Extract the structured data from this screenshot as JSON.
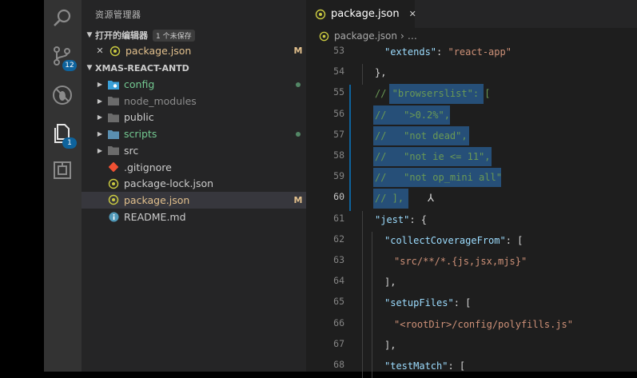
{
  "colors": {
    "accent": "#0e639c",
    "modified": "#e2c08d",
    "git_added": "#73c991",
    "json_icon": "#cbcb41"
  },
  "activity_bar": {
    "items": [
      {
        "name": "search-icon"
      },
      {
        "name": "source-control-icon",
        "badge": "12"
      },
      {
        "name": "debug-icon"
      },
      {
        "name": "explorer-icon",
        "badge": "1"
      },
      {
        "name": "extensions-icon"
      }
    ]
  },
  "sidebar": {
    "title": "资源管理器",
    "open_editors": {
      "header": "打开的编辑器",
      "badge": "1 个未保存",
      "items": [
        {
          "close": "✕",
          "label": "package.json",
          "status": "M"
        }
      ]
    },
    "project": {
      "header": "XMAS-REACT-ANTD",
      "items": [
        {
          "label": "config",
          "type": "folder",
          "icon": "config-folder-icon",
          "color": "#73c991"
        },
        {
          "label": "node_modules",
          "type": "folder",
          "icon": "node-modules-folder-icon",
          "color": "#8c8c8c"
        },
        {
          "label": "public",
          "type": "folder",
          "icon": "public-folder-icon",
          "color": "#cccccc"
        },
        {
          "label": "scripts",
          "type": "folder",
          "icon": "scripts-folder-icon",
          "color": "#73c991"
        },
        {
          "label": "src",
          "type": "folder",
          "icon": "src-folder-icon",
          "color": "#cccccc"
        },
        {
          "label": ".gitignore",
          "type": "file",
          "icon": "git-icon",
          "color": "#cccccc"
        },
        {
          "label": "package-lock.json",
          "type": "file",
          "icon": "json-file-icon",
          "color": "#cccccc"
        },
        {
          "label": "package.json",
          "type": "file",
          "icon": "json-file-icon",
          "color": "#e2c08d",
          "status": "M"
        },
        {
          "label": "README.md",
          "type": "file",
          "icon": "info-icon",
          "color": "#cccccc"
        }
      ]
    }
  },
  "editor": {
    "tab": {
      "label": "package.json",
      "close": "✕"
    },
    "breadcrumb": {
      "file": "package.json",
      "more": "…"
    },
    "lines": [
      {
        "num": "53",
        "text": "\"extends\": \"react-app\""
      },
      {
        "num": "54",
        "text": "},"
      },
      {
        "num": "55",
        "text": "// \"browserslist\": ["
      },
      {
        "num": "56",
        "text": "//   \">0.2%\","
      },
      {
        "num": "57",
        "text": "//   \"not dead\","
      },
      {
        "num": "58",
        "text": "//   \"not ie <= 11\","
      },
      {
        "num": "59",
        "text": "//   \"not op_mini all\""
      },
      {
        "num": "60",
        "text": "// ],"
      },
      {
        "num": "61",
        "text": "\"jest\": {"
      },
      {
        "num": "62",
        "text": "\"collectCoverageFrom\": ["
      },
      {
        "num": "63",
        "text": "\"src/**/*.{js,jsx,mjs}\""
      },
      {
        "num": "64",
        "text": "],"
      },
      {
        "num": "65",
        "text": "\"setupFiles\": ["
      },
      {
        "num": "66",
        "text": "\"<rootDir>/config/polyfills.js\""
      },
      {
        "num": "67",
        "text": "],"
      },
      {
        "num": "68",
        "text": "\"testMatch\": ["
      }
    ]
  }
}
